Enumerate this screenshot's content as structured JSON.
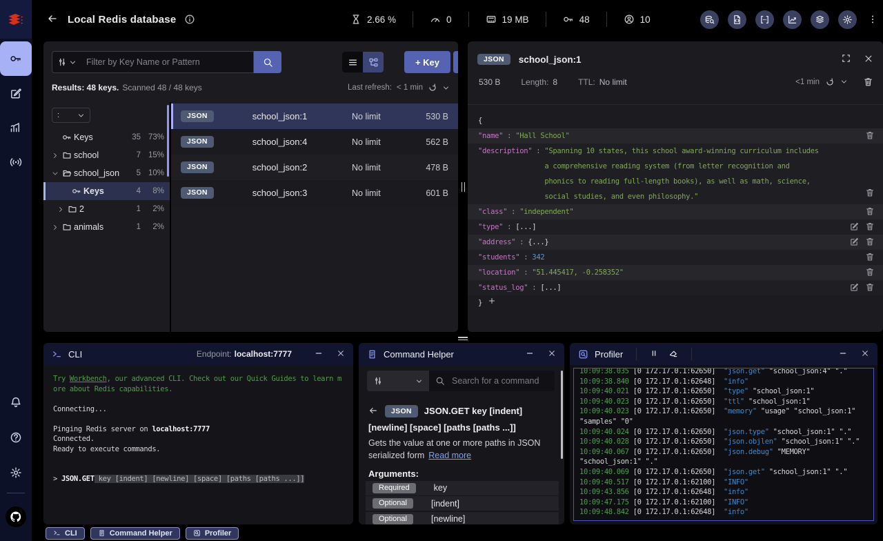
{
  "header": {
    "title": "Local Redis database",
    "stats": [
      {
        "icon": "hourglass",
        "value": "2.66 %"
      },
      {
        "icon": "gauge",
        "value": "0"
      },
      {
        "icon": "memory",
        "value": "19 MB"
      },
      {
        "icon": "key",
        "value": "48"
      },
      {
        "icon": "users",
        "value": "10"
      }
    ],
    "tools": [
      "db-search",
      "file-code",
      "grid-code",
      "chart-line",
      "layers",
      "gear"
    ]
  },
  "sidebar": {
    "nav": [
      {
        "id": "browser",
        "icon": "key",
        "active": true
      },
      {
        "id": "workbench",
        "icon": "pencil-square",
        "active": false
      },
      {
        "id": "analytics",
        "icon": "chart",
        "active": false
      },
      {
        "id": "pubsub",
        "icon": "pubsub",
        "active": false
      }
    ],
    "bottom": [
      {
        "id": "notifications",
        "icon": "bell"
      },
      {
        "id": "help",
        "icon": "help"
      },
      {
        "id": "settings",
        "icon": "gear"
      }
    ]
  },
  "browser": {
    "filter_placeholder": "Filter by Key Name or Pattern",
    "results_strong": "Results: 48 keys.",
    "results_rest": "Scanned 48 / 48 keys",
    "last_refresh_label": "Last refresh:",
    "last_refresh_value": "< 1 min",
    "add_key_label": "+ Key",
    "delimiter": ":",
    "tree": [
      {
        "label": "Keys",
        "icon": "key",
        "count": "35",
        "pct": "73%",
        "indent": 1,
        "chevron": null,
        "selected": false
      },
      {
        "label": "school",
        "icon": "folder",
        "count": "7",
        "pct": "15%",
        "indent": 0,
        "chevron": "right",
        "selected": false
      },
      {
        "label": "school_json",
        "icon": "folder-open",
        "count": "5",
        "pct": "10%",
        "indent": 0,
        "chevron": "down",
        "selected": false
      },
      {
        "label": "Keys",
        "icon": "key",
        "count": "4",
        "pct": "8%",
        "indent": 2,
        "chevron": null,
        "selected": true
      },
      {
        "label": "2",
        "icon": "folder",
        "count": "1",
        "pct": "2%",
        "indent": 1,
        "chevron": "right",
        "selected": false
      },
      {
        "label": "animals",
        "icon": "folder",
        "count": "1",
        "pct": "2%",
        "indent": 0,
        "chevron": "right",
        "selected": false
      }
    ],
    "keys": [
      {
        "badge": "JSON",
        "name": "school_json:1",
        "ttl": "No limit",
        "size": "530 B",
        "selected": true
      },
      {
        "badge": "JSON",
        "name": "school_json:4",
        "ttl": "No limit",
        "size": "562 B",
        "selected": false
      },
      {
        "badge": "JSON",
        "name": "school_json:2",
        "ttl": "No limit",
        "size": "478 B",
        "selected": false
      },
      {
        "badge": "JSON",
        "name": "school_json:3",
        "ttl": "No limit",
        "size": "601 B",
        "selected": false
      }
    ]
  },
  "detail": {
    "badge": "JSON",
    "key_name": "school_json:1",
    "size": "530 B",
    "length_label": "Length:",
    "length_value": "8",
    "ttl_label": "TTL:",
    "ttl_value": "No limit",
    "refresh_value": "<1 min",
    "open_brace": "{",
    "close_brace": "}",
    "fields": [
      {
        "key": "name",
        "value": "\"Hall School\"",
        "type": "string",
        "edit": false,
        "multiline": false
      },
      {
        "key": "description",
        "value": "\"Spanning 10 states, this school award-winning curriculum includes a comprehensive reading system (from letter recognition and phonics to reading full-length books), as well as math, science, social studies, and even philosophy.\"",
        "type": "string",
        "edit": false,
        "multiline": true
      },
      {
        "key": "class",
        "value": "\"independent\"",
        "type": "string",
        "edit": false,
        "multiline": false
      },
      {
        "key": "type",
        "value": "[...]",
        "type": "collapsed",
        "edit": true,
        "multiline": false
      },
      {
        "key": "address",
        "value": "{...}",
        "type": "collapsed",
        "edit": true,
        "multiline": false
      },
      {
        "key": "students",
        "value": "342",
        "type": "number",
        "edit": false,
        "multiline": false
      },
      {
        "key": "location",
        "value": "\"51.445417, -0.258352\"",
        "type": "string",
        "edit": false,
        "multiline": false
      },
      {
        "key": "status_log",
        "value": "[...]",
        "type": "collapsed",
        "edit": true,
        "multiline": false
      }
    ]
  },
  "cli": {
    "title": "CLI",
    "endpoint_label": "Endpoint:",
    "endpoint_value": "localhost:7777",
    "lines": [
      [
        {
          "t": "Try ",
          "s": "green"
        },
        {
          "t": "Workbench",
          "s": "green-link"
        },
        {
          "t": ", our advanced CLI. Check out our Quick Guides to learn m",
          "s": "green"
        }
      ],
      [
        {
          "t": "ore about Redis capabilities.",
          "s": "green"
        }
      ],
      [],
      [
        {
          "t": "Connecting...",
          "s": "plain"
        }
      ],
      [],
      [
        {
          "t": "Pinging Redis server on ",
          "s": "plain"
        },
        {
          "t": "localhost:7777",
          "s": "bold"
        }
      ],
      [
        {
          "t": "Connected.",
          "s": "plain"
        }
      ],
      [
        {
          "t": "Ready to execute commands.",
          "s": "plain"
        }
      ],
      [],
      [],
      [
        {
          "t": "> ",
          "s": "plain"
        },
        {
          "t": "JSON.GET",
          "s": "bold"
        },
        {
          "t": " key [indent] [newline] [space] [paths [paths ...]]",
          "s": "hint"
        }
      ]
    ]
  },
  "helper": {
    "title": "Command Helper",
    "search_placeholder": "Search for a command",
    "badge": "JSON",
    "command": "JSON.GET key [indent] [newline] [space] [paths [paths ...]]",
    "summary": "Gets the value at one or more paths in JSON serialized form",
    "read_more": "Read more",
    "arguments_label": "Arguments:",
    "args": [
      {
        "badge": "Required",
        "name": "key"
      },
      {
        "badge": "Optional",
        "name": "[indent]"
      },
      {
        "badge": "Optional",
        "name": "[newline]"
      }
    ]
  },
  "profiler": {
    "title": "Profiler",
    "lines": [
      {
        "time": "10:09:38.035",
        "client": "[0 172.17.0.1:62650]",
        "cmd": "\"json.get\"",
        "args": " \"school_json:4\" \".\""
      },
      {
        "time": "10:09:38.840",
        "client": "[0 172.17.0.1:62648]",
        "cmd": "\"info\"",
        "args": ""
      },
      {
        "time": "10:09:40.021",
        "client": "[0 172.17.0.1:62650]",
        "cmd": "\"type\"",
        "args": " \"school_json:1\""
      },
      {
        "time": "10:09:40.023",
        "client": "[0 172.17.0.1:62650]",
        "cmd": "\"ttl\"",
        "args": " \"school_json:1\""
      },
      {
        "time": "10:09:40.023",
        "client": "[0 172.17.0.1:62650]",
        "cmd": "\"memory\"",
        "args": " \"usage\" \"school_json:1\" \"samples\" \"0\""
      },
      {
        "time": "10:09:40.024",
        "client": "[0 172.17.0.1:62650]",
        "cmd": "\"json.type\"",
        "args": " \"school_json:1\" \".\""
      },
      {
        "time": "10:09:40.028",
        "client": "[0 172.17.0.1:62650]",
        "cmd": "\"json.objlen\"",
        "args": " \"school_json:1\" \".\""
      },
      {
        "time": "10:09:40.067",
        "client": "[0 172.17.0.1:62650]",
        "cmd": "\"json.debug\"",
        "args": " \"MEMORY\" \"school_json:1\" \".\""
      },
      {
        "time": "10:09:40.069",
        "client": "[0 172.17.0.1:62650]",
        "cmd": "\"json.get\"",
        "args": " \"school_json:1\" \".\""
      },
      {
        "time": "10:09:40.517",
        "client": "[0 172.17.0.1:62100]",
        "cmd": "\"INFO\"",
        "args": ""
      },
      {
        "time": "10:09:43.856",
        "client": "[0 172.17.0.1:62648]",
        "cmd": "\"info\"",
        "args": ""
      },
      {
        "time": "10:09:47.175",
        "client": "[0 172.17.0.1:62100]",
        "cmd": "\"INFO\"",
        "args": ""
      },
      {
        "time": "10:09:48.842",
        "client": "[0 172.17.0.1:62648]",
        "cmd": "\"info\"",
        "args": ""
      }
    ]
  },
  "bottombar": {
    "tabs": [
      {
        "label": "CLI",
        "icon": "terminal"
      },
      {
        "label": "Command Helper",
        "icon": "doc"
      },
      {
        "label": "Profiler",
        "icon": "profiler"
      }
    ]
  },
  "colors": {
    "accent": "#5663b2",
    "selection": "#a6b2f5",
    "json_key": "#c478c4",
    "json_string": "#83a75a",
    "json_number": "#4f9cd9",
    "profiler_border": "#4956c8"
  }
}
